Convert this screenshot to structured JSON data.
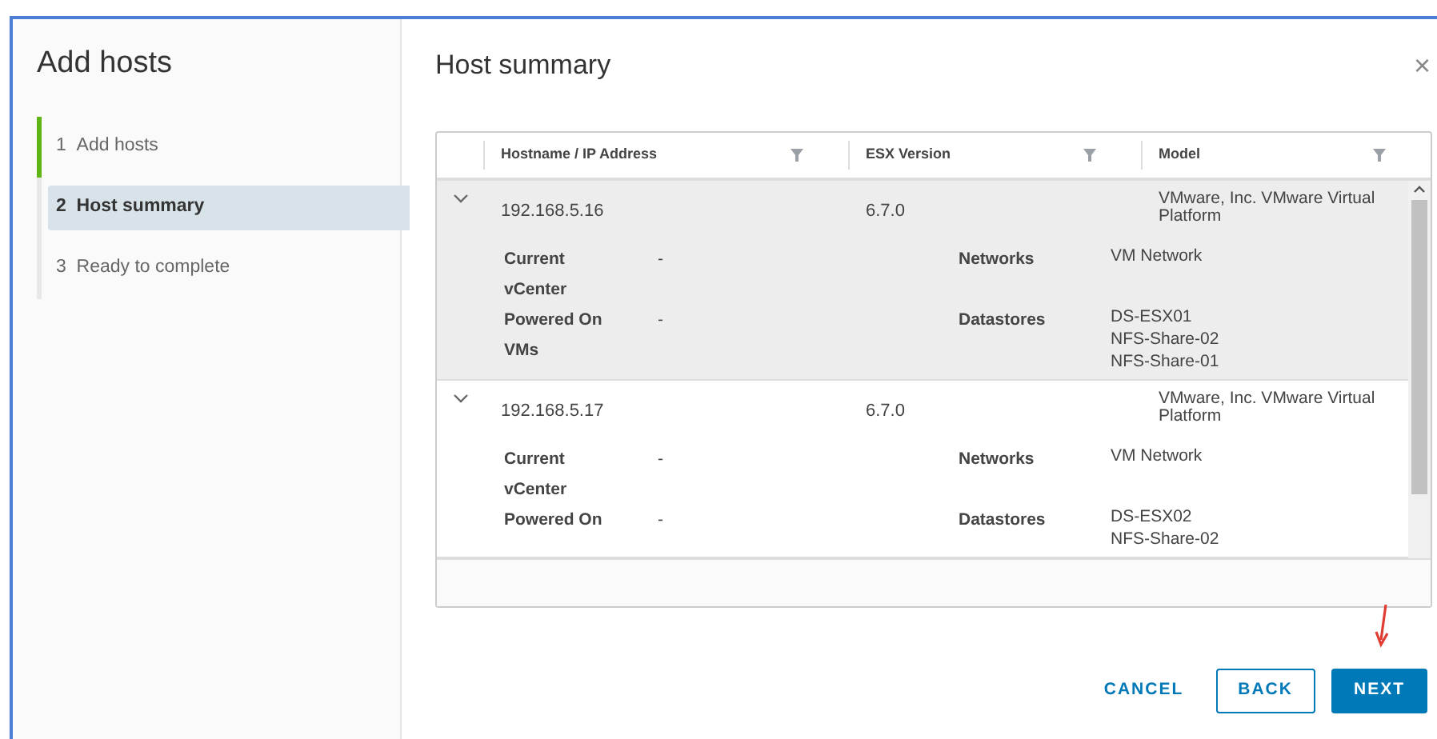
{
  "wizard": {
    "title": "Add hosts",
    "steps": [
      {
        "number": "1",
        "label": "Add hosts",
        "selected": false,
        "completed": true
      },
      {
        "number": "2",
        "label": "Host summary",
        "selected": true,
        "completed": false
      },
      {
        "number": "3",
        "label": "Ready to complete",
        "selected": false,
        "completed": false
      }
    ]
  },
  "page": {
    "title": "Host summary",
    "close": "×"
  },
  "table": {
    "columns": [
      "Hostname / IP Address",
      "ESX Version",
      "Model"
    ],
    "rows": [
      {
        "expanded": true,
        "selected": true,
        "hostname": "192.168.5.16",
        "version": "6.7.0",
        "model": "VMware, Inc. VMware Virtual Platform",
        "current_vcenter_label": "Current vCenter",
        "current_vcenter": "-",
        "powered_on_label": "Powered On VMs",
        "powered_on": "-",
        "networks_label": "Networks",
        "networks": [
          "VM Network"
        ],
        "datastores_label": "Datastores",
        "datastores": [
          "DS-ESX01",
          "NFS-Share-02",
          "NFS-Share-01"
        ]
      },
      {
        "expanded": true,
        "selected": false,
        "hostname": "192.168.5.17",
        "version": "6.7.0",
        "model": "VMware, Inc. VMware Virtual Platform",
        "current_vcenter_label": "Current vCenter",
        "current_vcenter": "-",
        "powered_on_label": "Powered On",
        "powered_on": "-",
        "networks_label": "Networks",
        "networks": [
          "VM Network"
        ],
        "datastores_label": "Datastores",
        "datastores": [
          "DS-ESX02",
          "NFS-Share-02"
        ]
      }
    ]
  },
  "buttons": [
    {
      "label": "CANCEL",
      "kind": "flat"
    },
    {
      "label": "BACK",
      "kind": "outline"
    },
    {
      "label": "NEXT",
      "kind": "primary"
    }
  ]
}
